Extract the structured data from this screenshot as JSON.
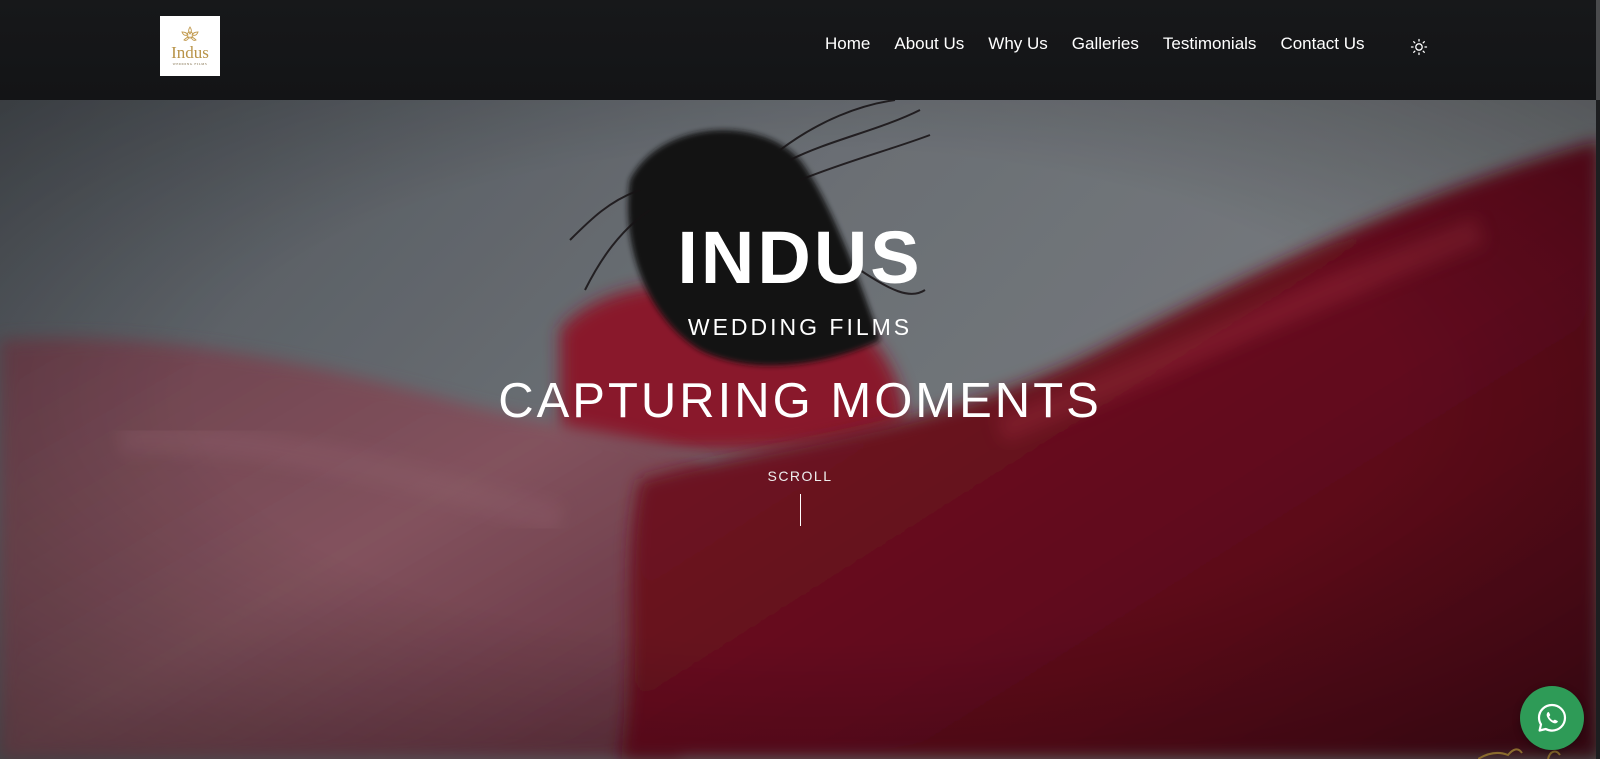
{
  "header": {
    "logo": {
      "word": "Indus",
      "sub": "WEDDING FILMS",
      "color": "#b89348"
    },
    "nav": [
      {
        "label": "Home"
      },
      {
        "label": "About Us"
      },
      {
        "label": "Why Us"
      },
      {
        "label": "Galleries"
      },
      {
        "label": "Testimonials"
      },
      {
        "label": "Contact Us"
      }
    ],
    "theme_toggle_icon": "sun-icon"
  },
  "hero": {
    "title": "INDUS",
    "subtitle": "WEDDING FILMS",
    "tagline": "CAPTURING MOMENTS",
    "scroll_label": "SCROLL"
  },
  "floating": {
    "whatsapp_icon": "whatsapp-icon",
    "whatsapp_color": "#2e9b57"
  }
}
